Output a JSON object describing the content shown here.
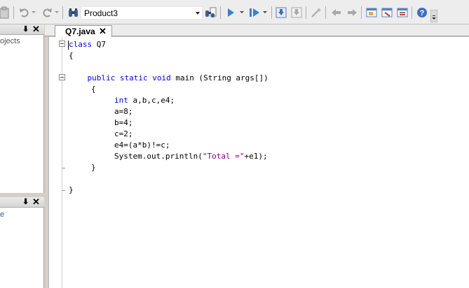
{
  "toolbar": {
    "project_selector": "Product3"
  },
  "panels": {
    "top_text": "ojects",
    "bottom_text": "e",
    "pin_glyph": "⬇",
    "close_glyph": "✕"
  },
  "editor": {
    "tab_label": "Q7.java",
    "tab_close": "✕"
  },
  "code": {
    "line1_kw": "class",
    "line1_rest": " Q7",
    "line2": "{",
    "line4_kw": "public static void",
    "line4_rest": " main (String args[])",
    "line5": "{",
    "line6_kw": "int",
    "line6_rest": " a,b,c,e4;",
    "line7": "a=8;",
    "line8": "b=4;",
    "line9": "c=2;",
    "line10": "e4=(a*b)!=c;",
    "line11_pre": "System.out.println(",
    "line11_str": "\"Total =\"",
    "line11_post": "+e1);",
    "line12": "}",
    "line14": "}"
  }
}
